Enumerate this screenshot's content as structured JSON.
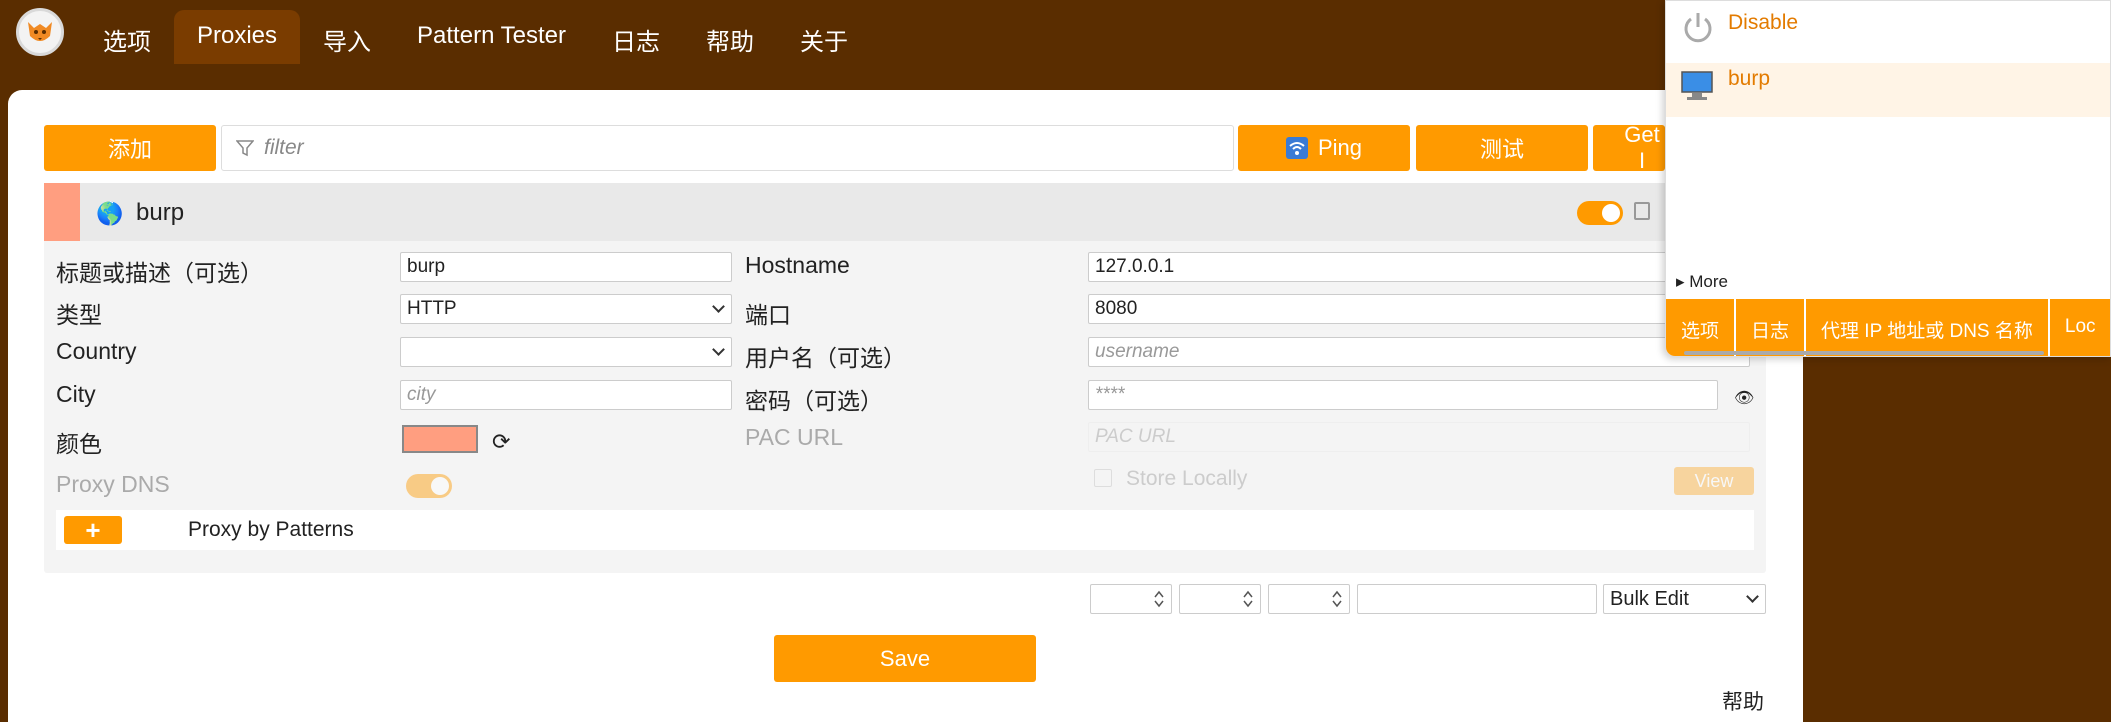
{
  "nav": {
    "tabs": [
      "选项",
      "Proxies",
      "导入",
      "Pattern Tester",
      "日志",
      "帮助",
      "关于"
    ],
    "active": "Proxies"
  },
  "toolbar": {
    "add_label": "添加",
    "filter_placeholder": "filter",
    "ping_label": "Ping",
    "test_label": "测试",
    "get_label": "Get I"
  },
  "proxy": {
    "name": "burp",
    "color": "#ff9e80",
    "enabled": true,
    "fields": {
      "title_label": "标题或描述（可选）",
      "title_value": "burp",
      "type_label": "类型",
      "type_value": "HTTP",
      "country_label": "Country",
      "country_value": "",
      "city_label": "City",
      "city_placeholder": "city",
      "color_label": "颜色",
      "proxydns_label": "Proxy DNS",
      "hostname_label": "Hostname",
      "hostname_value": "127.0.0.1",
      "port_label": "端口",
      "port_value": "8080",
      "username_label": "用户名（可选）",
      "username_placeholder": "username",
      "password_label": "密码（可选）",
      "password_placeholder": "****",
      "pacurl_label": "PAC URL",
      "pacurl_placeholder": "PAC URL",
      "store_locally_label": "Store Locally",
      "view_label": "View"
    },
    "patterns_label": "Proxy by Patterns",
    "plus_label": "+"
  },
  "bulk_edit": {
    "select_value": "Bulk Edit"
  },
  "save_label": "Save",
  "help_label": "帮助",
  "popup": {
    "disable_label": "Disable",
    "proxy_label": "burp",
    "more_label": "▸ More",
    "tabs": [
      "选项",
      "日志",
      "代理 IP 地址或 DNS 名称",
      "Loc"
    ]
  }
}
